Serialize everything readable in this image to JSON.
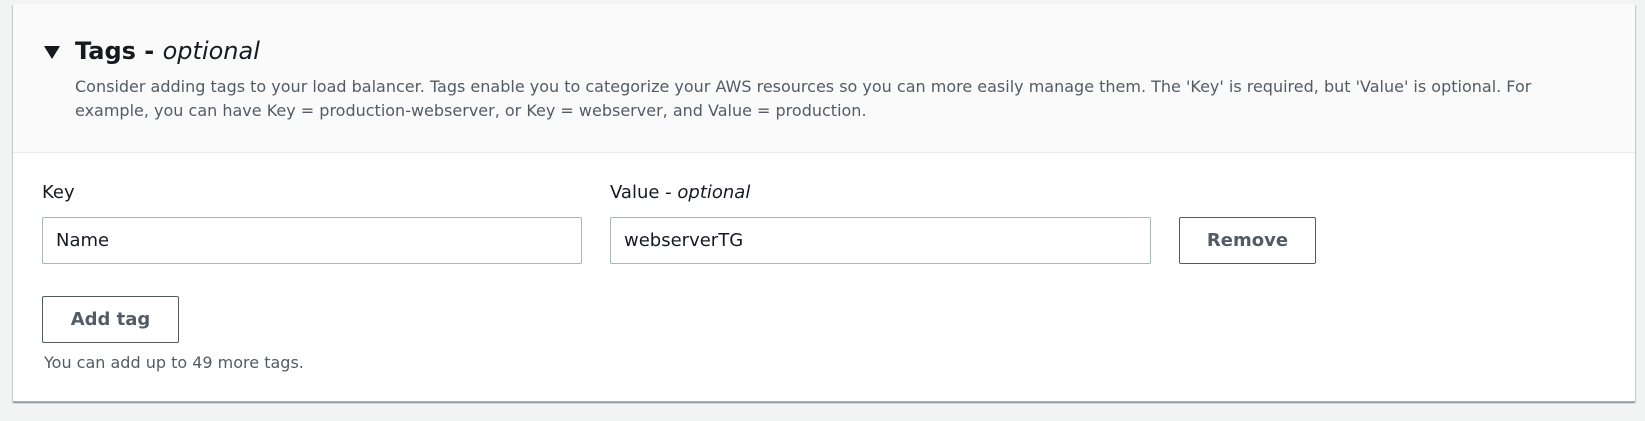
{
  "section": {
    "title": "Tags - ",
    "title_optional": "optional",
    "description": "Consider adding tags to your load balancer. Tags enable you to categorize your AWS resources so you can more easily manage them. The 'Key' is required, but 'Value' is optional. For example, you can have Key = production-webserver, or Key = webserver, and Value = production.",
    "expanded": true
  },
  "tag_row": {
    "key_label": "Key",
    "value_label": "Value - ",
    "value_label_optional": "optional",
    "key_value": "Name",
    "value_value": "webserverTG",
    "remove_label": "Remove"
  },
  "add_tag_label": "Add tag",
  "hint": "You can add up to 49 more tags.",
  "colors": {
    "page_background": "#f2f3f3",
    "header_background": "#fafafa",
    "button_border": "#545b64",
    "input_border": "#aab7b8"
  },
  "icons": {
    "expand": "caret-down-icon"
  }
}
